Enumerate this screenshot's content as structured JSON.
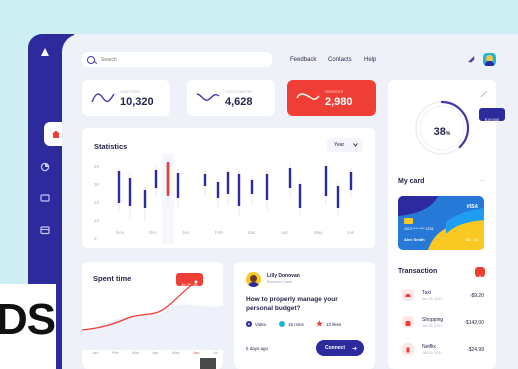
{
  "top_nav": {
    "search_placeholder": "Search",
    "links": [
      "Feedback",
      "Contacts",
      "Help"
    ]
  },
  "stats": [
    {
      "label": "Visitors",
      "value": "10,320"
    },
    {
      "label": "Customers",
      "value": "4,628"
    },
    {
      "label": "Orders",
      "value": "2,980"
    }
  ],
  "statistics": {
    "title": "Statistics",
    "period": "Year",
    "y_ticks": [
      "50",
      "30",
      "10",
      "10",
      "0"
    ],
    "x_ticks": [
      "Nov",
      "Dec",
      "Jan",
      "Feb",
      "Mar",
      "Apr",
      "May",
      "Jun"
    ]
  },
  "progress": {
    "value": "38",
    "unit": "%",
    "fraction": 0.38
  },
  "balance_tag": "$19,600",
  "my_card": {
    "title": "My card",
    "brand": "VISA",
    "holder": "Alex Smith",
    "number": "4313 **** **** 1234",
    "expiry": "08 / 24"
  },
  "spent_time": {
    "title": "Spent time",
    "tooltip": "4h 26min",
    "x_ticks": [
      "Jan",
      "Feb",
      "Mar",
      "Apr",
      "May",
      "Jun",
      "Jul"
    ],
    "active_tick": "Jun"
  },
  "article": {
    "author": "Lilly Donovan",
    "role": "Business Coach",
    "title": "How to properly manage your personal budget?",
    "meta": [
      "Video",
      "15 mins",
      "12 likes"
    ],
    "time_ago": "5 days ago",
    "button": "Connect"
  },
  "transactions": {
    "title": "Transaction",
    "items": [
      {
        "name": "Taxi",
        "date": "Jan 23, 2021",
        "amount": "-$9,20"
      },
      {
        "name": "Shopping",
        "date": "Jan 22, 2021",
        "amount": "-$142,00"
      },
      {
        "name": "Netflix",
        "date": "Jan 20, 2021",
        "amount": "-$24.99"
      }
    ]
  },
  "overlay_text": "DS",
  "colors": {
    "primary": "#2d2a9e",
    "accent_red": "#ef3e36",
    "card_blue": "#2779d8",
    "card_yellow": "#f9c823",
    "background": "#eef1f8"
  }
}
